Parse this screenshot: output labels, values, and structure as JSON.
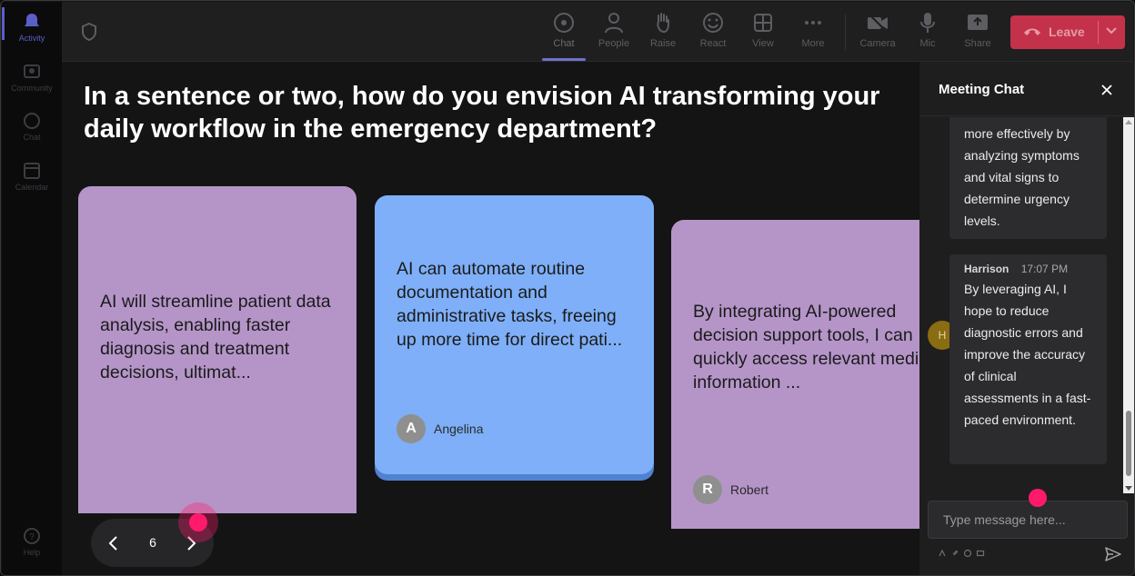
{
  "rail": {
    "items": [
      {
        "label": "Activity",
        "icon": "bell-icon"
      },
      {
        "label": "Community",
        "icon": "community-icon"
      },
      {
        "label": "Chat",
        "icon": "chat-icon"
      },
      {
        "label": "Calendar",
        "icon": "calendar-icon"
      }
    ],
    "help": {
      "label": "Help",
      "icon": "help-icon"
    }
  },
  "toolbar": {
    "buttons": [
      {
        "label": "Chat",
        "icon": "chat-icon"
      },
      {
        "label": "People",
        "icon": "people-icon"
      },
      {
        "label": "Raise",
        "icon": "raise-hand-icon"
      },
      {
        "label": "React",
        "icon": "react-icon"
      },
      {
        "label": "View",
        "icon": "view-icon"
      },
      {
        "label": "More",
        "icon": "more-icon"
      },
      {
        "label": "Camera",
        "icon": "camera-off-icon"
      },
      {
        "label": "Mic",
        "icon": "mic-icon"
      },
      {
        "label": "Share",
        "icon": "share-icon"
      }
    ],
    "leave_label": "Leave",
    "accent_color": "#c4314b"
  },
  "stage": {
    "question": {
      "line1": "In a sentence or two, how do you envision AI transforming your",
      "line2": "daily workflow in the emergency department?"
    },
    "cards": [
      {
        "text": "AI will streamline patient data analysis, enabling faster diagnosis and treatment decisions, ultimat...",
        "color": "#b595c8"
      },
      {
        "text": "AI can automate routine documentation and administrative tasks, freeing up more time for direct pati...",
        "color": "#7eaff8",
        "author": "Angelina",
        "initial": "A"
      },
      {
        "text": "By integrating AI-powered decision support tools, I can quickly access relevant medical information ...",
        "color": "#b595c8",
        "author": "Robert",
        "initial": "R"
      }
    ],
    "pager": {
      "page": "6"
    }
  },
  "chat": {
    "title": "Meeting Chat",
    "messages": [
      {
        "text": "more effectively by analyzing symptoms and vital signs to determine urgency levels."
      },
      {
        "sender": "Harrison",
        "initial": "H",
        "time": "17:07 PM",
        "text": "By leveraging AI, I hope to reduce diagnostic errors and improve the accuracy of clinical assessments in a fast-paced environment."
      }
    ],
    "input_placeholder": "Type message here..."
  }
}
